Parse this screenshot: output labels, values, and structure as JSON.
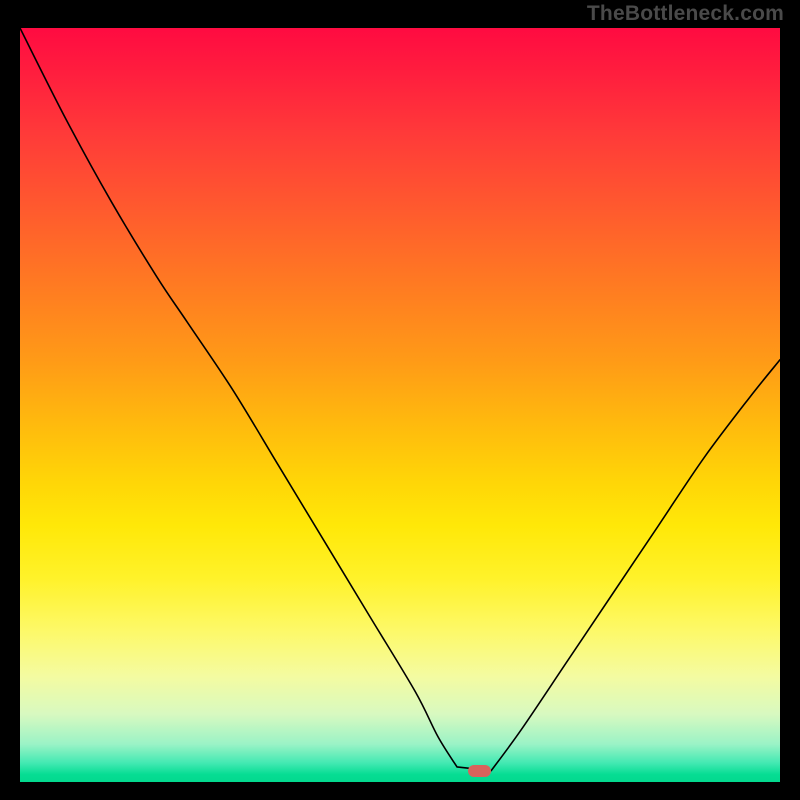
{
  "watermark": "TheBottleneck.com",
  "colors": {
    "curve_stroke": "#000000",
    "marker_fill": "#d9635c",
    "frame_bg": "#000000"
  },
  "chart_data": {
    "type": "line",
    "title": "",
    "xlabel": "",
    "ylabel": "",
    "xlim": [
      0,
      100
    ],
    "ylim": [
      0,
      100
    ],
    "note": "Chart has no visible axes, ticks, or legend. Values are estimated from a 0–100 normalized coordinate space (0,0 at top-left of the colored plot area).",
    "gradient_stops": [
      {
        "pct": 0,
        "hex": "#ff0b41"
      },
      {
        "pct": 14,
        "hex": "#ff3a39"
      },
      {
        "pct": 34,
        "hex": "#ff7a22"
      },
      {
        "pct": 52,
        "hex": "#ffb80e"
      },
      {
        "pct": 66,
        "hex": "#ffe808"
      },
      {
        "pct": 80,
        "hex": "#fdf969"
      },
      {
        "pct": 91,
        "hex": "#d8f9c0"
      },
      {
        "pct": 97,
        "hex": "#42e9b2"
      },
      {
        "pct": 100,
        "hex": "#03d98e"
      }
    ],
    "series": [
      {
        "name": "bottleneck-curve",
        "x": [
          0,
          6,
          12,
          18,
          22,
          28,
          34,
          40,
          46,
          52,
          55,
          57.5,
          59.5,
          62,
          66,
          72,
          78,
          84,
          90,
          96,
          100
        ],
        "y": [
          0,
          12,
          23,
          33,
          39,
          48,
          58,
          68,
          78,
          88,
          94,
          98,
          98.5,
          98.5,
          93,
          84,
          75,
          66,
          57,
          49,
          44
        ]
      }
    ],
    "flat_segment": {
      "x_start": 57.5,
      "x_end": 62,
      "y": 98.5
    },
    "marker": {
      "x": 60.5,
      "y": 98.5
    }
  }
}
